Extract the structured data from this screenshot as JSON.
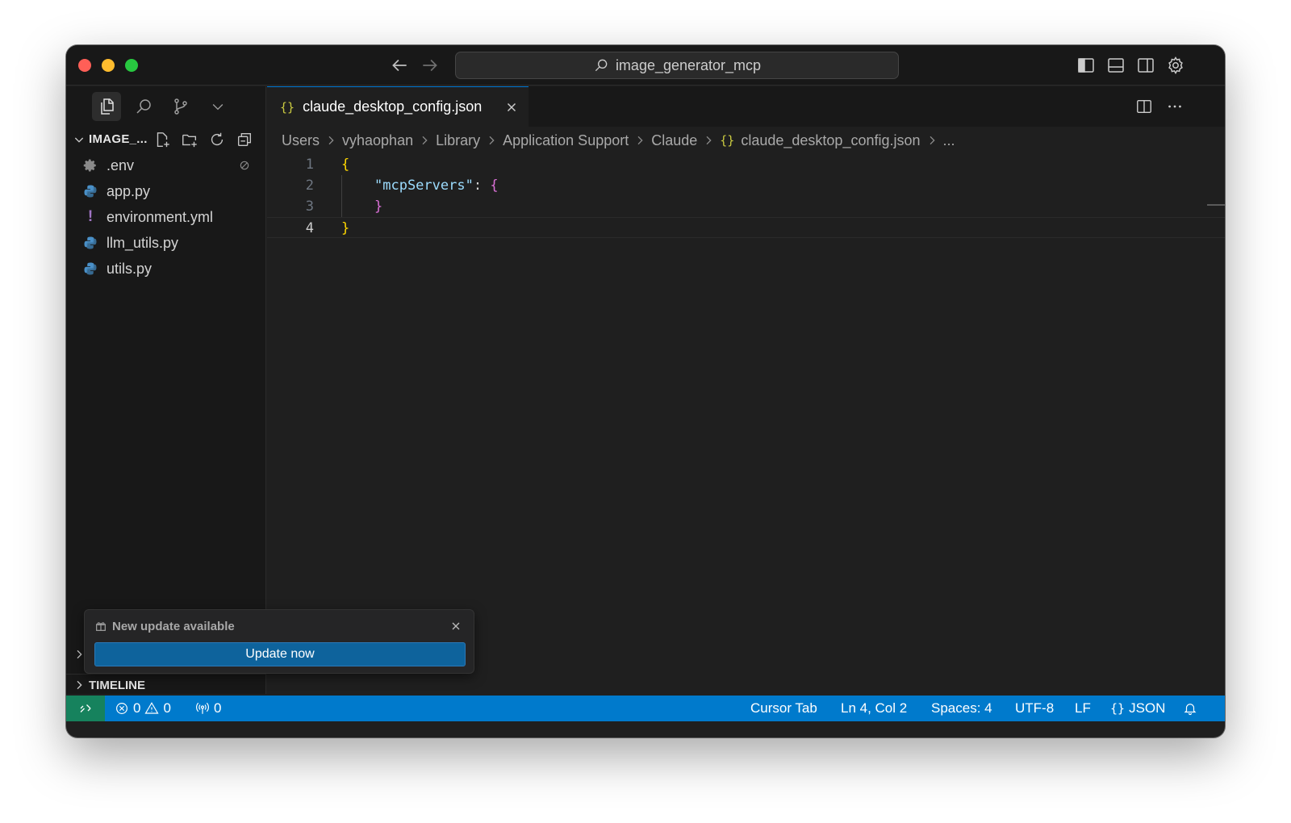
{
  "window": {
    "command_center": "image_generator_mcp"
  },
  "sidebar": {
    "explorer_title": "IMAGE_...",
    "files": [
      {
        "name": ".env",
        "icon": "gear-icon"
      },
      {
        "name": "app.py",
        "icon": "python-icon"
      },
      {
        "name": "environment.yml",
        "icon": "yaml-icon"
      },
      {
        "name": "llm_utils.py",
        "icon": "python-icon"
      },
      {
        "name": "utils.py",
        "icon": "python-icon"
      }
    ],
    "timeline_label": "TIMELINE"
  },
  "editor": {
    "tab_label": "claude_desktop_config.json",
    "tab_icon": "{}",
    "breadcrumb": [
      "Users",
      "vyhaophan",
      "Library",
      "Application Support",
      "Claude",
      "claude_desktop_config.json",
      "..."
    ],
    "lines": [
      {
        "n": "1",
        "text": "{"
      },
      {
        "n": "2",
        "key": "\"mcpServers\"",
        "rest": ": ",
        "open": "{"
      },
      {
        "n": "3",
        "close": "}"
      },
      {
        "n": "4",
        "text": "}"
      }
    ]
  },
  "notification": {
    "message": "New update available",
    "button_label": "Update now"
  },
  "statusbar": {
    "errors": "0",
    "warnings": "0",
    "ports": "0",
    "cursor_tab": "Cursor Tab",
    "position": "Ln 4, Col 2",
    "spaces": "Spaces: 4",
    "encoding": "UTF-8",
    "eol": "LF",
    "language_icon": "{}",
    "language": "JSON"
  },
  "colors": {
    "accent": "#007acc",
    "remote": "#16825d",
    "button": "#0e639c",
    "json_icon": "#cbcb41"
  }
}
